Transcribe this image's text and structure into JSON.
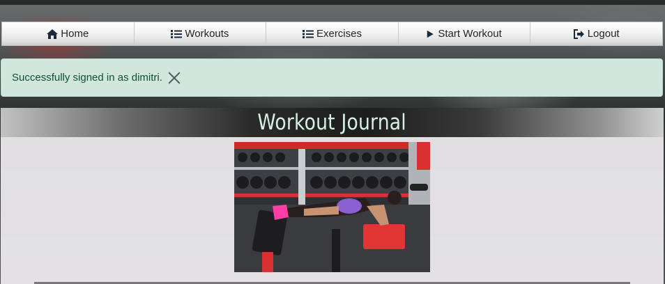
{
  "nav": {
    "items": [
      {
        "label": "Home",
        "icon": "home-icon"
      },
      {
        "label": "Workouts",
        "icon": "list-icon"
      },
      {
        "label": "Exercises",
        "icon": "list-icon"
      },
      {
        "label": "Start Workout",
        "icon": "play-icon"
      },
      {
        "label": "Logout",
        "icon": "logout-icon"
      }
    ]
  },
  "alert": {
    "message": "Successfully signed in as dimitri.",
    "color": "#d1e7dd"
  },
  "main": {
    "title": "Workout Journal",
    "photo": "gym-workout-photo"
  },
  "colors": {
    "accent_title": "#d6f1e1",
    "alert_text": "#0f5132"
  }
}
